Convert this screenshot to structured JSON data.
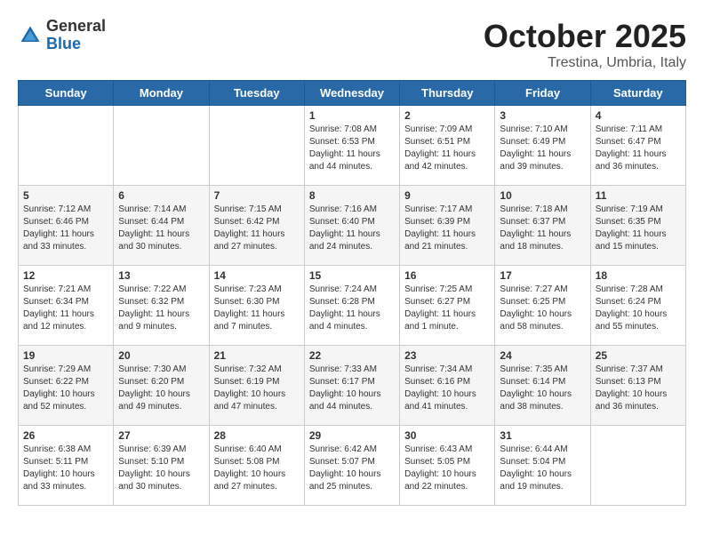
{
  "logo": {
    "general": "General",
    "blue": "Blue"
  },
  "header": {
    "month": "October 2025",
    "location": "Trestina, Umbria, Italy"
  },
  "weekdays": [
    "Sunday",
    "Monday",
    "Tuesday",
    "Wednesday",
    "Thursday",
    "Friday",
    "Saturday"
  ],
  "weeks": [
    {
      "days": [
        {
          "num": "",
          "info": ""
        },
        {
          "num": "",
          "info": ""
        },
        {
          "num": "",
          "info": ""
        },
        {
          "num": "1",
          "info": "Sunrise: 7:08 AM\nSunset: 6:53 PM\nDaylight: 11 hours\nand 44 minutes."
        },
        {
          "num": "2",
          "info": "Sunrise: 7:09 AM\nSunset: 6:51 PM\nDaylight: 11 hours\nand 42 minutes."
        },
        {
          "num": "3",
          "info": "Sunrise: 7:10 AM\nSunset: 6:49 PM\nDaylight: 11 hours\nand 39 minutes."
        },
        {
          "num": "4",
          "info": "Sunrise: 7:11 AM\nSunset: 6:47 PM\nDaylight: 11 hours\nand 36 minutes."
        }
      ]
    },
    {
      "days": [
        {
          "num": "5",
          "info": "Sunrise: 7:12 AM\nSunset: 6:46 PM\nDaylight: 11 hours\nand 33 minutes."
        },
        {
          "num": "6",
          "info": "Sunrise: 7:14 AM\nSunset: 6:44 PM\nDaylight: 11 hours\nand 30 minutes."
        },
        {
          "num": "7",
          "info": "Sunrise: 7:15 AM\nSunset: 6:42 PM\nDaylight: 11 hours\nand 27 minutes."
        },
        {
          "num": "8",
          "info": "Sunrise: 7:16 AM\nSunset: 6:40 PM\nDaylight: 11 hours\nand 24 minutes."
        },
        {
          "num": "9",
          "info": "Sunrise: 7:17 AM\nSunset: 6:39 PM\nDaylight: 11 hours\nand 21 minutes."
        },
        {
          "num": "10",
          "info": "Sunrise: 7:18 AM\nSunset: 6:37 PM\nDaylight: 11 hours\nand 18 minutes."
        },
        {
          "num": "11",
          "info": "Sunrise: 7:19 AM\nSunset: 6:35 PM\nDaylight: 11 hours\nand 15 minutes."
        }
      ]
    },
    {
      "days": [
        {
          "num": "12",
          "info": "Sunrise: 7:21 AM\nSunset: 6:34 PM\nDaylight: 11 hours\nand 12 minutes."
        },
        {
          "num": "13",
          "info": "Sunrise: 7:22 AM\nSunset: 6:32 PM\nDaylight: 11 hours\nand 9 minutes."
        },
        {
          "num": "14",
          "info": "Sunrise: 7:23 AM\nSunset: 6:30 PM\nDaylight: 11 hours\nand 7 minutes."
        },
        {
          "num": "15",
          "info": "Sunrise: 7:24 AM\nSunset: 6:28 PM\nDaylight: 11 hours\nand 4 minutes."
        },
        {
          "num": "16",
          "info": "Sunrise: 7:25 AM\nSunset: 6:27 PM\nDaylight: 11 hours\nand 1 minute."
        },
        {
          "num": "17",
          "info": "Sunrise: 7:27 AM\nSunset: 6:25 PM\nDaylight: 10 hours\nand 58 minutes."
        },
        {
          "num": "18",
          "info": "Sunrise: 7:28 AM\nSunset: 6:24 PM\nDaylight: 10 hours\nand 55 minutes."
        }
      ]
    },
    {
      "days": [
        {
          "num": "19",
          "info": "Sunrise: 7:29 AM\nSunset: 6:22 PM\nDaylight: 10 hours\nand 52 minutes."
        },
        {
          "num": "20",
          "info": "Sunrise: 7:30 AM\nSunset: 6:20 PM\nDaylight: 10 hours\nand 49 minutes."
        },
        {
          "num": "21",
          "info": "Sunrise: 7:32 AM\nSunset: 6:19 PM\nDaylight: 10 hours\nand 47 minutes."
        },
        {
          "num": "22",
          "info": "Sunrise: 7:33 AM\nSunset: 6:17 PM\nDaylight: 10 hours\nand 44 minutes."
        },
        {
          "num": "23",
          "info": "Sunrise: 7:34 AM\nSunset: 6:16 PM\nDaylight: 10 hours\nand 41 minutes."
        },
        {
          "num": "24",
          "info": "Sunrise: 7:35 AM\nSunset: 6:14 PM\nDaylight: 10 hours\nand 38 minutes."
        },
        {
          "num": "25",
          "info": "Sunrise: 7:37 AM\nSunset: 6:13 PM\nDaylight: 10 hours\nand 36 minutes."
        }
      ]
    },
    {
      "days": [
        {
          "num": "26",
          "info": "Sunrise: 6:38 AM\nSunset: 5:11 PM\nDaylight: 10 hours\nand 33 minutes."
        },
        {
          "num": "27",
          "info": "Sunrise: 6:39 AM\nSunset: 5:10 PM\nDaylight: 10 hours\nand 30 minutes."
        },
        {
          "num": "28",
          "info": "Sunrise: 6:40 AM\nSunset: 5:08 PM\nDaylight: 10 hours\nand 27 minutes."
        },
        {
          "num": "29",
          "info": "Sunrise: 6:42 AM\nSunset: 5:07 PM\nDaylight: 10 hours\nand 25 minutes."
        },
        {
          "num": "30",
          "info": "Sunrise: 6:43 AM\nSunset: 5:05 PM\nDaylight: 10 hours\nand 22 minutes."
        },
        {
          "num": "31",
          "info": "Sunrise: 6:44 AM\nSunset: 5:04 PM\nDaylight: 10 hours\nand 19 minutes."
        },
        {
          "num": "",
          "info": ""
        }
      ]
    }
  ]
}
